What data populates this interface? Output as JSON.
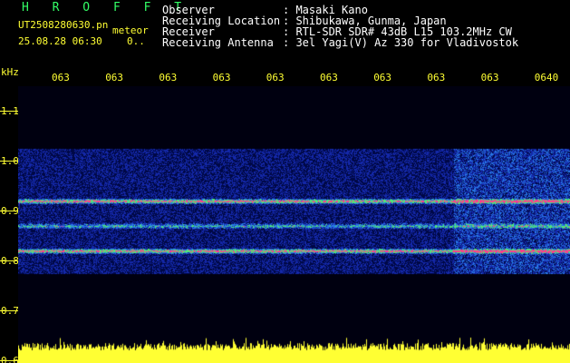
{
  "header": {
    "app_name": "H R O F F T",
    "filename": "UT2508280630.pn",
    "tag": "meteor",
    "datetime": "25.08.28 06:30",
    "count": "0.."
  },
  "station": {
    "labels": [
      "Observer",
      "Receiving Location",
      "Receiver",
      "Receiving Antenna"
    ],
    "values": [
      ": Masaki Kano",
      ": Shibukawa, Gunma, Japan",
      ": RTL-SDR SDR# 43dB L15 103.2MHz CW",
      ": 3el Yagi(V) Az 330 for Vladivostok"
    ]
  },
  "chart_data": {
    "type": "heatmap",
    "ylabel": "kHz",
    "y_ticks": [
      "1.1",
      "1.0",
      "0.9",
      "0.8",
      "0.7",
      "0.6"
    ],
    "x_ticks": [
      "063",
      "063",
      "063",
      "063",
      "063",
      "063",
      "063",
      "063",
      "063",
      "0640"
    ],
    "ylim": [
      0.6,
      1.1
    ],
    "signal_band_khz": [
      0.775,
      1.025
    ],
    "carrier_lines_khz": [
      0.92,
      0.87,
      0.82
    ],
    "colors": {
      "axis": "#ffff33",
      "noise": "#1a2a9a",
      "carrier": "#ff3377",
      "mid": "#33ff66"
    }
  }
}
